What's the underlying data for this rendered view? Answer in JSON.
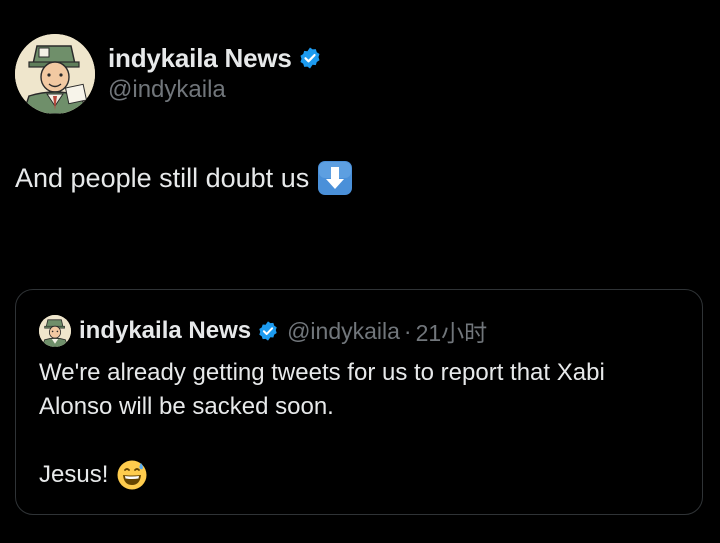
{
  "tweet": {
    "author": {
      "name": "indykaila News",
      "handle": "@indykaila",
      "verified": true
    },
    "text": "And people still doubt us",
    "emoji": "down-arrow-emoji"
  },
  "quoted_tweet": {
    "author": {
      "name": "indykaila News",
      "handle": "@indykaila",
      "verified": true
    },
    "separator": "·",
    "time": "21小时",
    "text_line1": "We're already getting tweets for us to report that Xabi",
    "text_line2": "Alonso will be sacked soon.",
    "text_line3": "Jesus!",
    "emoji": "grinning-sweat-emoji"
  },
  "colors": {
    "background": "#000000",
    "text_primary": "#e7e9ea",
    "text_secondary": "#71767b",
    "verified_blue": "#1d9bf0",
    "border": "#2f3336"
  }
}
